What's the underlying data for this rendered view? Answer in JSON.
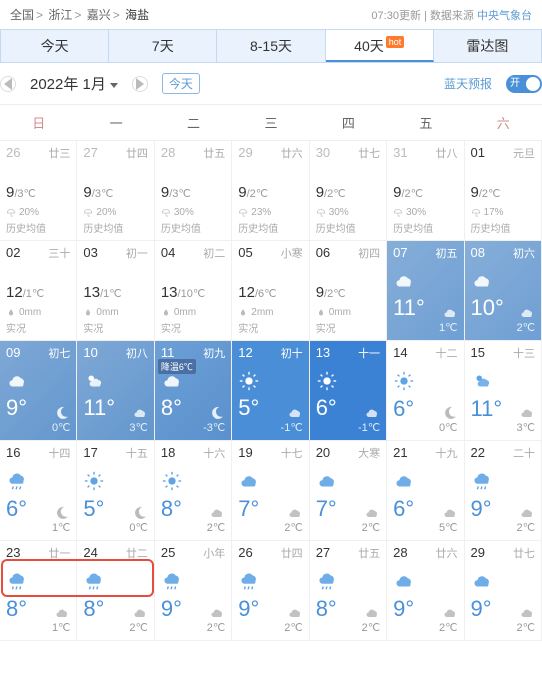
{
  "breadcrumb": {
    "root": "全国",
    "prov": "浙江",
    "city": "嘉兴",
    "dist": "海盐"
  },
  "meta": {
    "update": "07:30更新",
    "srclabel": "数据来源",
    "src": "中央气象台"
  },
  "tabs": {
    "t1": "今天",
    "t2": "7天",
    "t3": "8-15天",
    "t4": "40天",
    "t5": "雷达图",
    "hot": "hot"
  },
  "nav": {
    "month": "2022年 1月",
    "today": "今天",
    "forecast": "蓝天预报",
    "toggle": "开"
  },
  "week": {
    "d0": "日",
    "d1": "一",
    "d2": "二",
    "d3": "三",
    "d4": "四",
    "d5": "五",
    "d6": "六"
  },
  "history_label": "历史均值",
  "actual_label": "实况",
  "tag_cool": "降温6℃",
  "days": [
    {
      "d": "26",
      "l": "廿三",
      "hi": "9",
      "lo": "/3℃",
      "sub": "20%",
      "subtype": "rain",
      "hist": true,
      "faded": true
    },
    {
      "d": "27",
      "l": "廿四",
      "hi": "9",
      "lo": "/3℃",
      "sub": "20%",
      "subtype": "rain",
      "hist": true,
      "faded": true
    },
    {
      "d": "28",
      "l": "廿五",
      "hi": "9",
      "lo": "/3℃",
      "sub": "30%",
      "subtype": "rain",
      "hist": true,
      "faded": true
    },
    {
      "d": "29",
      "l": "廿六",
      "hi": "9",
      "lo": "/2℃",
      "sub": "23%",
      "subtype": "rain",
      "hist": true,
      "faded": true
    },
    {
      "d": "30",
      "l": "廿七",
      "hi": "9",
      "lo": "/2℃",
      "sub": "30%",
      "subtype": "rain",
      "hist": true,
      "faded": true
    },
    {
      "d": "31",
      "l": "廿八",
      "hi": "9",
      "lo": "/2℃",
      "sub": "30%",
      "subtype": "rain",
      "hist": true,
      "faded": true
    },
    {
      "d": "01",
      "l": "元旦",
      "hi": "9",
      "lo": "/2℃",
      "sub": "17%",
      "subtype": "rain",
      "hist": true
    },
    {
      "d": "02",
      "l": "三十",
      "hi": "12",
      "lo": "/1℃",
      "sub": "0mm",
      "subtype": "drop",
      "act": true
    },
    {
      "d": "03",
      "l": "初一",
      "hi": "13",
      "lo": "/1℃",
      "sub": "0mm",
      "subtype": "drop",
      "act": true
    },
    {
      "d": "04",
      "l": "初二",
      "hi": "13",
      "lo": "/10℃",
      "sub": "0mm",
      "subtype": "drop",
      "act": true
    },
    {
      "d": "05",
      "l": "小寒",
      "hi": "12",
      "lo": "/6℃",
      "sub": "2mm",
      "subtype": "drop",
      "act": true
    },
    {
      "d": "06",
      "l": "初四",
      "hi": "9",
      "lo": "/2℃",
      "sub": "0mm",
      "subtype": "drop",
      "act": true
    },
    {
      "d": "07",
      "l": "初五",
      "fc": true,
      "cls": "grad1",
      "hi": "11°",
      "night": "1℃",
      "dicon": "cloud",
      "nicon": "cloud"
    },
    {
      "d": "08",
      "l": "初六",
      "fc": true,
      "cls": "grad1",
      "hi": "10°",
      "night": "2℃",
      "dicon": "cloud",
      "nicon": "cloud"
    },
    {
      "d": "09",
      "l": "初七",
      "fc": true,
      "cls": "grad2",
      "hi": "9°",
      "night": "0℃",
      "dicon": "cloud",
      "nicon": "moon"
    },
    {
      "d": "10",
      "l": "初八",
      "fc": true,
      "cls": "grad2",
      "hi": "11°",
      "night": "3℃",
      "dicon": "suncloud",
      "nicon": "cloud"
    },
    {
      "d": "11",
      "l": "初九",
      "fc": true,
      "cls": "grad3",
      "hi": "8°",
      "night": "-3℃",
      "dicon": "cloud",
      "nicon": "moon",
      "tag": true
    },
    {
      "d": "12",
      "l": "初十",
      "fc": true,
      "cls": "blue1",
      "hi": "5°",
      "night": "-1℃",
      "dicon": "sun",
      "nicon": "cloud"
    },
    {
      "d": "13",
      "l": "十一",
      "fc": true,
      "cls": "blue2",
      "hi": "6°",
      "night": "-1℃",
      "dicon": "sun",
      "nicon": "cloud"
    },
    {
      "d": "14",
      "l": "十二",
      "white": true,
      "hi": "6°",
      "night": "0℃",
      "dicon": "sun",
      "nicon": "moon"
    },
    {
      "d": "15",
      "l": "十三",
      "white": true,
      "hi": "11°",
      "night": "3℃",
      "dicon": "suncloud",
      "nicon": "cloud"
    },
    {
      "d": "16",
      "l": "十四",
      "white": true,
      "hi": "6°",
      "night": "1℃",
      "dicon": "rain",
      "nicon": "moon"
    },
    {
      "d": "17",
      "l": "十五",
      "white": true,
      "hi": "5°",
      "night": "0℃",
      "dicon": "sun",
      "nicon": "moon"
    },
    {
      "d": "18",
      "l": "十六",
      "white": true,
      "hi": "8°",
      "night": "2℃",
      "dicon": "sun",
      "nicon": "cloud"
    },
    {
      "d": "19",
      "l": "十七",
      "white": true,
      "hi": "7°",
      "night": "2℃",
      "dicon": "cloud",
      "nicon": "cloud"
    },
    {
      "d": "20",
      "l": "大寒",
      "white": true,
      "hi": "7°",
      "night": "2℃",
      "dicon": "cloud",
      "nicon": "cloud"
    },
    {
      "d": "21",
      "l": "十九",
      "white": true,
      "hi": "6°",
      "night": "5℃",
      "dicon": "cloud",
      "nicon": "cloud"
    },
    {
      "d": "22",
      "l": "二十",
      "white": true,
      "hi": "9°",
      "night": "2℃",
      "dicon": "rain",
      "nicon": "cloud"
    },
    {
      "d": "23",
      "l": "廿一",
      "white": true,
      "hi": "8°",
      "night": "1℃",
      "dicon": "rain",
      "nicon": "cloud"
    },
    {
      "d": "24",
      "l": "廿二",
      "white": true,
      "hi": "8°",
      "night": "2℃",
      "dicon": "rain",
      "nicon": "cloud"
    },
    {
      "d": "25",
      "l": "小年",
      "white": true,
      "hi": "9°",
      "night": "2℃",
      "dicon": "rain",
      "nicon": "cloud"
    },
    {
      "d": "26",
      "l": "廿四",
      "white": true,
      "hi": "9°",
      "night": "2℃",
      "dicon": "rain",
      "nicon": "cloud"
    },
    {
      "d": "27",
      "l": "廿五",
      "white": true,
      "hi": "8°",
      "night": "2℃",
      "dicon": "rain",
      "nicon": "cloud"
    },
    {
      "d": "28",
      "l": "廿六",
      "white": true,
      "hi": "9°",
      "night": "2℃",
      "dicon": "cloud",
      "nicon": "cloud"
    },
    {
      "d": "29",
      "l": "廿七",
      "white": true,
      "hi": "9°",
      "night": "2℃",
      "dicon": "cloud",
      "nicon": "cloud"
    }
  ]
}
